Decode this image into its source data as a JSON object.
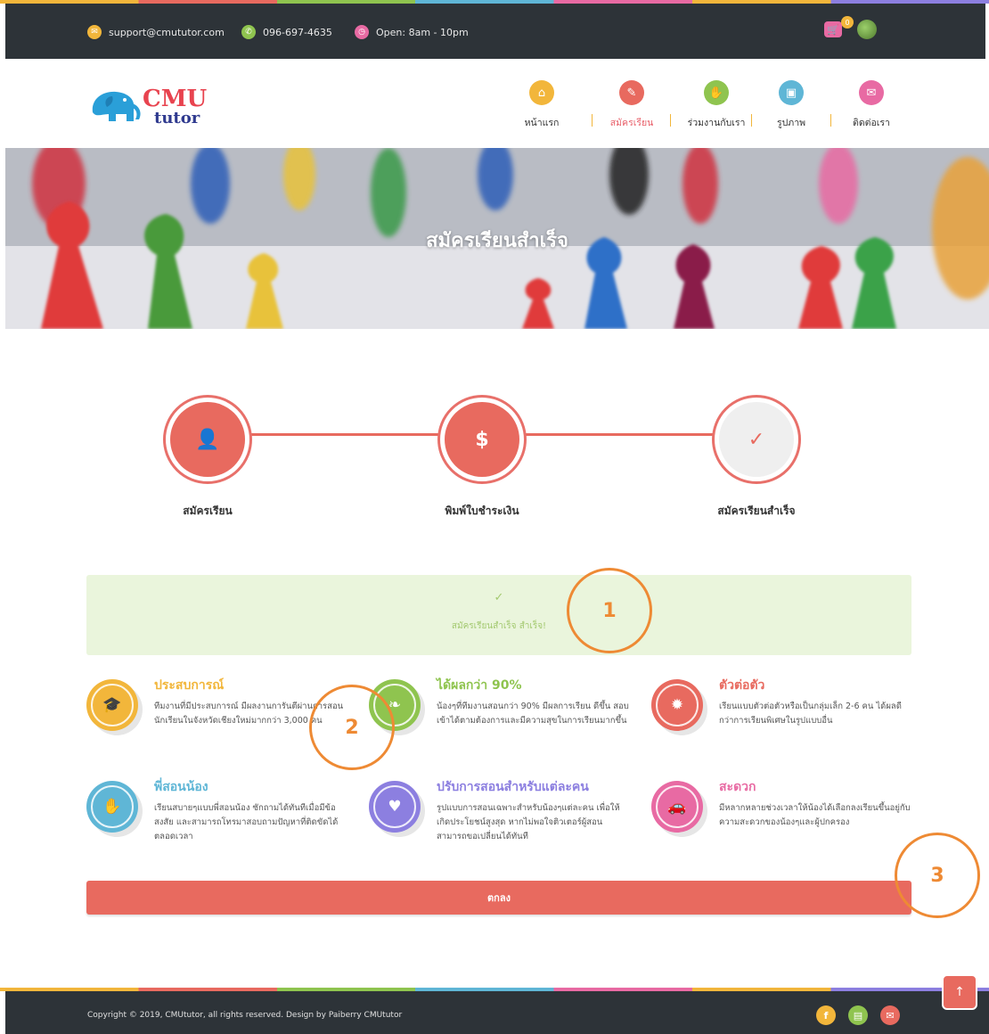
{
  "topbar": {
    "email": "support@cmututor.com",
    "phone": "096-697-4635",
    "hours": "Open: 8am - 10pm",
    "cart_count": "0",
    "icons": [
      "email-icon",
      "phone-icon",
      "clock-icon",
      "cart-icon",
      "user-avatar"
    ],
    "colors": {
      "email": "#f2b63b",
      "phone": "#8fc44f",
      "clock": "#e86aa3"
    }
  },
  "logo": {
    "cmu": "CMU",
    "tutor": "tutor"
  },
  "nav": {
    "items": [
      {
        "label": "หน้าแรก",
        "icon": "home-icon",
        "color": "#f2b63b"
      },
      {
        "label": "สมัครเรียน",
        "icon": "pencil-icon",
        "color": "#e86a5f",
        "active": true
      },
      {
        "label": "ร่วมงานกับเรา",
        "icon": "handshake-icon",
        "color": "#8fc44f"
      },
      {
        "label": "รูปภาพ",
        "icon": "image-icon",
        "color": "#5fb6d6"
      },
      {
        "label": "ติดต่อเรา",
        "icon": "mail-icon",
        "color": "#e86aa3"
      }
    ]
  },
  "hero": {
    "title": "สมัครเรียนสำเร็จ"
  },
  "steps": [
    {
      "label": "สมัครเรียน",
      "icon": "user-icon"
    },
    {
      "label": "พิมพ์ใบชำระเงิน",
      "icon": "dollar-icon"
    },
    {
      "label": "สมัครเรียนสำเร็จ",
      "icon": "check-icon"
    }
  ],
  "alert": {
    "text": "สมัครเรียนสำเร็จ สำเร็จ!"
  },
  "features": [
    {
      "title": "ประสบการณ์",
      "text": "ทีมงานที่มีประสบการณ์ มีผลงานการันตีผ่านการสอนนักเรียนในจังหวัดเชียงใหม่มากกว่า 3,000 คน",
      "color": "#f2b63b",
      "icon": "graduation-cap-icon"
    },
    {
      "title": "ได้ผลกว่า 90%",
      "text": "น้องๆที่ทีมงานสอนกว่า 90% มีผลการเรียน ดีขึ้น สอบเข้าได้ตามต้องการและมีความสุขในการเรียนมากขึ้น",
      "color": "#8fc44f",
      "icon": "leaf-icon"
    },
    {
      "title": "ตัวต่อตัว",
      "text": "เรียนแบบตัวต่อตัวหรือเป็นกลุ่มเล็ก 2-6 คน ได้ผลดีกว่าการเรียนพิเศษในรูปแบบอื่น",
      "color": "#e86a5f",
      "icon": "gear-icon"
    },
    {
      "title": "พี่สอนน้อง",
      "text": "เรียนสบายๆแบบพี่สอนน้อง ซักถามได้ทันทีเมื่อมีข้อสงสัย และสามารถโทรมาสอบถามปัญหาที่ติดขัดได้ตลอดเวลา",
      "color": "#5fb6d6",
      "icon": "handshake-icon"
    },
    {
      "title": "ปรับการสอนสำหรับแต่ละคน",
      "text": "รูปแบบการสอนเฉพาะสำหรับน้องๆแต่ละคน เพื่อให้เกิดประโยชน์สูงสุด หากไม่พอใจติวเตอร์ผู้สอน สามารถขอเปลี่ยนได้ทันที",
      "color": "#8c7fe0",
      "icon": "heart-icon"
    },
    {
      "title": "สะดวก",
      "text": "มีหลากหลายช่วงเวลาให้น้องได้เลือกลงเรียนขึ้นอยู่กับความสะดวกของน้องๆและผู้ปกครอง",
      "color": "#e86aa3",
      "icon": "car-icon"
    }
  ],
  "button": {
    "label": "ตกลง"
  },
  "annotations": [
    "1",
    "2",
    "3"
  ],
  "footer": {
    "copyright": "Copyright © 2019, CMUtutor, all rights reserved. Design by Paiberry CMUtutor",
    "social": [
      {
        "icon": "facebook-icon",
        "glyph": "f",
        "color": "#f2b63b"
      },
      {
        "icon": "line-icon",
        "glyph": "▤",
        "color": "#8fc44f"
      },
      {
        "icon": "mail-icon",
        "glyph": "✉",
        "color": "#e86a5f"
      }
    ],
    "to_top": "↑"
  }
}
